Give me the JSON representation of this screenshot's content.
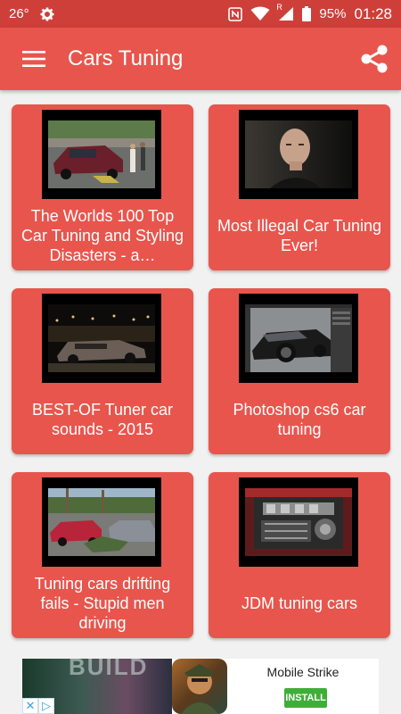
{
  "status_bar": {
    "temperature": "26°",
    "roaming": "R",
    "battery": "95%",
    "time": "01:28"
  },
  "app_bar": {
    "title": "Cars Tuning",
    "menu_icon": "hamburger-menu-icon",
    "share_icon": "share-icon"
  },
  "videos": [
    {
      "title": "The Worlds 100 Top Car Tuning and Styling Disasters - a…",
      "thumb": "crashed-car-parking-lot"
    },
    {
      "title": "Most Illegal Car Tuning Ever!",
      "thumb": "bald-man-portrait"
    },
    {
      "title": "BEST-OF Tuner car sounds - 2015",
      "thumb": "car-at-night-show"
    },
    {
      "title": "Photoshop cs6 car tuning",
      "thumb": "photoshop-car-edit"
    },
    {
      "title": "Tuning cars drifting fails - Stupid men driving",
      "thumb": "cars-street-fail"
    },
    {
      "title": "JDM tuning cars",
      "thumb": "engine-bay"
    }
  ],
  "ad": {
    "banner_text": "BUILD",
    "app_name": "Mobile Strike",
    "install_label": "INSTALL"
  },
  "colors": {
    "status_bar": "#ce3f39",
    "app_bar": "#e8554d",
    "card": "#e8554d",
    "background": "#f1f1f1",
    "install_button": "#3fae39"
  }
}
